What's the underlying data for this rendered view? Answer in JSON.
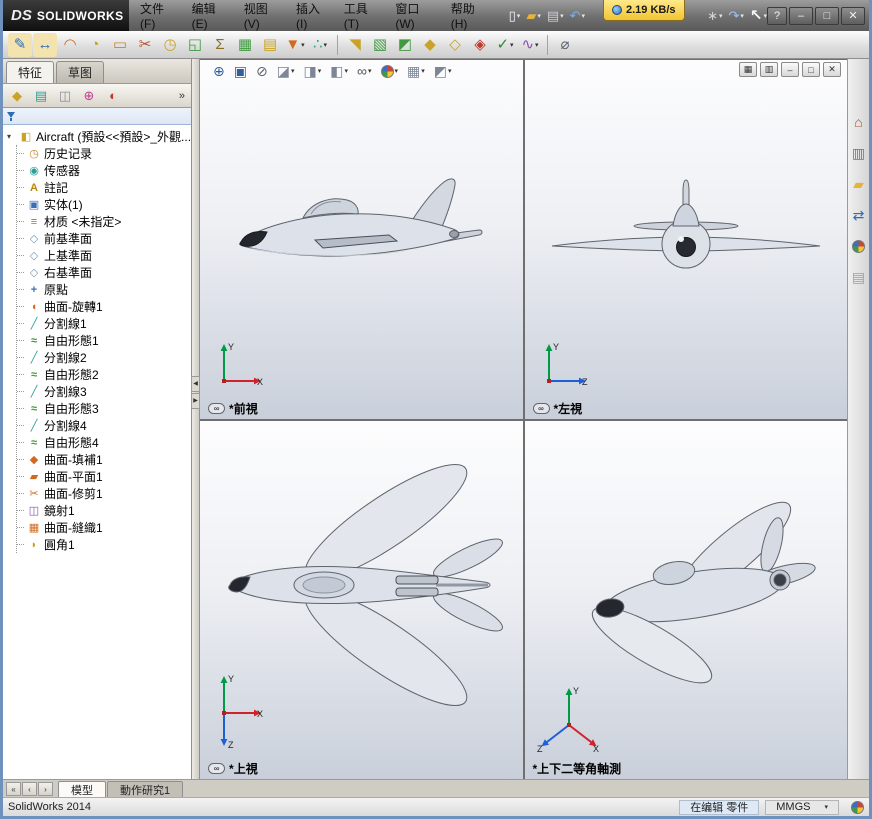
{
  "window": {
    "logo_mark": "DS",
    "logo_text": "SOLIDWORKS",
    "menus": [
      {
        "key": "file",
        "label": "文件(F)"
      },
      {
        "key": "edit",
        "label": "编辑(E)"
      },
      {
        "key": "view",
        "label": "视图(V)"
      },
      {
        "key": "insert",
        "label": "插入(I)"
      },
      {
        "key": "tools",
        "label": "工具(T)"
      },
      {
        "key": "window",
        "label": "窗口(W)"
      },
      {
        "key": "help",
        "label": "帮助(H)"
      }
    ],
    "quick_access": [
      {
        "name": "new-document-icon",
        "glyph": "▯",
        "color": "#f5f8fc",
        "caret": true
      },
      {
        "name": "open-document-icon",
        "glyph": "▰",
        "color": "#e6b23c",
        "caret": true
      },
      {
        "name": "save-document-icon",
        "glyph": "▤",
        "color": "#c9ced6",
        "caret": true
      },
      {
        "name": "undo-icon",
        "glyph": "↶",
        "color": "#7fb0e8",
        "caret": true
      }
    ],
    "quick_access_right": [
      {
        "name": "options-gear-icon",
        "glyph": "∗",
        "color": "#cfd4da",
        "caret": true
      },
      {
        "name": "redo-icon",
        "glyph": "↷",
        "color": "#9fc3ee",
        "caret": true
      }
    ],
    "network_overlay": {
      "speed": "2.19 KB/s"
    },
    "select_tool": {
      "name": "select-arrow-icon",
      "glyph": "↖",
      "caret": true
    },
    "help_button": "?",
    "controls": [
      {
        "name": "minimize-button",
        "glyph": "–"
      },
      {
        "name": "maximize-button",
        "glyph": "□"
      },
      {
        "name": "close-button",
        "glyph": "✕"
      }
    ]
  },
  "toolbar": {
    "icons": [
      {
        "name": "edit-sketch-icon",
        "glyph": "✎",
        "color": "#2d6cb3",
        "bg": "#f3e3ae"
      },
      {
        "name": "move-entities-icon",
        "glyph": "↔",
        "color": "#2d6cb3",
        "bg": "#f3e3ae"
      },
      {
        "name": "three-d-curve-icon",
        "glyph": "◠",
        "color": "#d2691e"
      },
      {
        "name": "reorder-icon",
        "glyph": "◔",
        "color": "#c9a227"
      },
      {
        "name": "rectangle-tool-icon",
        "glyph": "▭",
        "color": "#c9862b"
      },
      {
        "name": "trim-entities-icon",
        "glyph": "✂",
        "color": "#b0522d"
      },
      {
        "name": "history-bar-icon",
        "glyph": "◷",
        "color": "#c9a227"
      },
      {
        "name": "insert-part-icon",
        "glyph": "◱",
        "color": "#3f9b3f"
      },
      {
        "name": "equations-icon",
        "glyph": "Σ",
        "color": "#8a6d1f"
      },
      {
        "name": "design-table-icon",
        "glyph": "▦",
        "color": "#3f9b3f"
      },
      {
        "name": "annotations-icon",
        "glyph": "▤",
        "color": "#c9a227"
      },
      {
        "name": "selection-filter-icon",
        "glyph": "▼",
        "color": "#d2691e",
        "caret": true
      },
      {
        "name": "pattern-icon",
        "glyph": "∴",
        "color": "#2aa198",
        "caret": true
      },
      {
        "sep": true
      },
      {
        "name": "extruded-surface-icon",
        "glyph": "◥",
        "color": "#c9a227"
      },
      {
        "name": "planar-surface-icon",
        "glyph": "▧",
        "color": "#3f9b3f"
      },
      {
        "name": "knit-surface-icon",
        "glyph": "◩",
        "color": "#3f9b3f"
      },
      {
        "name": "filled-surface-icon",
        "glyph": "◆",
        "color": "#c9a227"
      },
      {
        "name": "offset-surface-icon",
        "glyph": "◇",
        "color": "#c9a227"
      },
      {
        "name": "delete-face-icon",
        "glyph": "◈",
        "color": "#c0392b"
      },
      {
        "name": "sketch-check-icon",
        "glyph": "✓",
        "color": "#2e8b2e",
        "caret": true
      },
      {
        "name": "spline-tools-icon",
        "glyph": "∿",
        "color": "#8a4fb0",
        "caret": true
      },
      {
        "sep": true
      },
      {
        "name": "measure-tool-icon",
        "glyph": "⌀",
        "color": "#5a6472"
      }
    ]
  },
  "feature_panel": {
    "tabs": [
      {
        "label": "特征",
        "active": true
      },
      {
        "label": "草图",
        "active": false
      }
    ],
    "manager_tabs": [
      {
        "name": "featuremanager-tab",
        "glyph": "◆",
        "color": "#c9a227"
      },
      {
        "name": "propertymanager-tab",
        "glyph": "▤",
        "color": "#2aa198"
      },
      {
        "name": "configurationmanager-tab",
        "glyph": "◫",
        "color": "#8a8f98"
      },
      {
        "name": "dimxpertmanager-tab",
        "glyph": "⊕",
        "color": "#c13f8e"
      },
      {
        "name": "displaymanager-tab",
        "glyph": "◐",
        "color": "#c0392b"
      }
    ],
    "overflow_label": "»",
    "root": {
      "label": "Aircraft (預設<<預設>_外觀...",
      "icon": "part"
    },
    "items": [
      {
        "label": "历史记录",
        "icon": "history"
      },
      {
        "label": "传感器",
        "icon": "sensors"
      },
      {
        "label": "註記",
        "icon": "annotations"
      },
      {
        "label": "实体(1)",
        "icon": "solids"
      },
      {
        "label": "材质 <未指定>",
        "icon": "material"
      },
      {
        "label": "前基準面",
        "icon": "plane"
      },
      {
        "label": "上基準面",
        "icon": "plane"
      },
      {
        "label": "右基準面",
        "icon": "plane"
      },
      {
        "label": "原點",
        "icon": "origin"
      },
      {
        "label": "曲面-旋轉1",
        "icon": "surf-revolve"
      },
      {
        "label": "分割線1",
        "icon": "splitline"
      },
      {
        "label": "自由形態1",
        "icon": "freeform"
      },
      {
        "label": "分割線2",
        "icon": "splitline"
      },
      {
        "label": "自由形態2",
        "icon": "freeform"
      },
      {
        "label": "分割線3",
        "icon": "splitline"
      },
      {
        "label": "自由形態3",
        "icon": "freeform"
      },
      {
        "label": "分割線4",
        "icon": "splitline"
      },
      {
        "label": "自由形態4",
        "icon": "freeform"
      },
      {
        "label": "曲面-填補1",
        "icon": "surf-fill"
      },
      {
        "label": "曲面-平面1",
        "icon": "surf-plane"
      },
      {
        "label": "曲面-修剪1",
        "icon": "surf-trim"
      },
      {
        "label": "鏡射1",
        "icon": "mirror"
      },
      {
        "label": "曲面-縫織1",
        "icon": "surf-knit"
      },
      {
        "label": "圓角1",
        "icon": "fillet"
      }
    ]
  },
  "hud": {
    "icons": [
      {
        "name": "zoom-to-fit-icon",
        "glyph": "⊕",
        "color": "#2f5f9e"
      },
      {
        "name": "zoom-to-area-icon",
        "glyph": "▣",
        "color": "#2f5f9e"
      },
      {
        "name": "magnified-selection-icon",
        "glyph": "⊘",
        "color": "#5a6472"
      },
      {
        "name": "section-view-icon",
        "glyph": "◪",
        "color": "#7c8696",
        "caret": true
      },
      {
        "name": "view-orientation-icon",
        "glyph": "◨",
        "color": "#7c8696",
        "caret": true
      },
      {
        "name": "display-style-icon",
        "glyph": "◧",
        "color": "#7c8696",
        "caret": true
      },
      {
        "name": "hide-show-items-icon",
        "glyph": "∞",
        "color": "#555555",
        "caret": true
      },
      {
        "name": "edit-appearance-icon",
        "kind": "ball",
        "caret": true
      },
      {
        "name": "apply-scene-icon",
        "glyph": "▦",
        "color": "#7c8696",
        "caret": true
      },
      {
        "name": "view-settings-icon",
        "glyph": "◩",
        "color": "#7c8696",
        "caret": true
      }
    ]
  },
  "doc_controls": [
    {
      "name": "viewport-layout-button",
      "glyph": "▦"
    },
    {
      "name": "viewport-single-button",
      "glyph": "▥"
    },
    {
      "name": "doc-minimize-button",
      "glyph": "–"
    },
    {
      "name": "doc-restore-button",
      "glyph": "□"
    },
    {
      "name": "doc-close-button",
      "glyph": "✕"
    }
  ],
  "viewports": [
    {
      "label": "*前視",
      "linked": true,
      "axes": [
        {
          "dir": "up",
          "label": "Y",
          "color": "#009a44"
        },
        {
          "dir": "right",
          "label": "X",
          "color": "#d22128"
        }
      ]
    },
    {
      "label": "*左視",
      "linked": true,
      "axes": [
        {
          "dir": "up",
          "label": "Y",
          "color": "#009a44"
        },
        {
          "dir": "right",
          "label": "Z",
          "color": "#1f5fd6"
        }
      ]
    },
    {
      "label": "*上視",
      "linked": true,
      "axes": [
        {
          "dir": "up",
          "label": "Y",
          "color": "#009a44"
        },
        {
          "dir": "right",
          "label": "X",
          "color": "#d22128"
        },
        {
          "dir": "down",
          "label": "Z",
          "color": "#1f5fd6"
        }
      ]
    },
    {
      "label": "*上下二等角軸測",
      "linked": false,
      "axes": [
        {
          "dir": "up",
          "label": "Y",
          "color": "#009a44"
        },
        {
          "dir": "dr",
          "label": "X",
          "color": "#d22128"
        },
        {
          "dir": "dl",
          "label": "Z",
          "color": "#1f5fd6"
        }
      ]
    }
  ],
  "task_pane": [
    {
      "name": "home-tab",
      "glyph": "⌂",
      "color": "#b0522d"
    },
    {
      "name": "resources-tab",
      "glyph": "▥",
      "color": "#3f9b3f"
    },
    {
      "name": "design-library-tab",
      "glyph": "▰",
      "color": "#e6b23c"
    },
    {
      "name": "file-explorer-tab",
      "glyph": "⇄",
      "color": "#2d6cb3"
    },
    {
      "name": "appearances-tab",
      "kind": "ball"
    },
    {
      "name": "custom-properties-tab",
      "glyph": "▤",
      "color": "#c9a227"
    }
  ],
  "motion_bar": {
    "nav": [
      {
        "name": "tab-first-button",
        "glyph": "«"
      },
      {
        "name": "tab-prev-button",
        "glyph": "‹"
      },
      {
        "name": "tab-next-button",
        "glyph": "›"
      }
    ],
    "tabs": [
      {
        "label": "模型",
        "active": true
      },
      {
        "label": "動作研究1",
        "active": false
      }
    ]
  },
  "status_bar": {
    "app": "SolidWorks 2014",
    "edit_mode": "在编辑 零件",
    "units": "MMGS"
  }
}
